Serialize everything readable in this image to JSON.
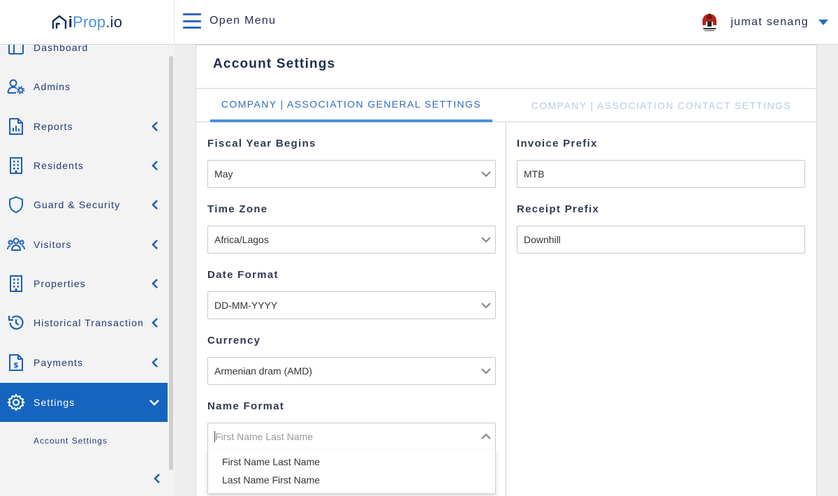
{
  "brand": {
    "i": "i",
    "prop": "Prop",
    "io": ".io"
  },
  "header": {
    "menu_label": "Open Menu",
    "user_name": "jumat senang"
  },
  "sidebar": {
    "items": [
      {
        "label": "Dashboard",
        "icon": "dashboard-icon"
      },
      {
        "label": "Admins",
        "icon": "admin-gear-icon"
      },
      {
        "label": "Reports",
        "icon": "report-icon"
      },
      {
        "label": "Residents",
        "icon": "building-icon"
      },
      {
        "label": "Guard & Security",
        "icon": "shield-icon"
      },
      {
        "label": "Visitors",
        "icon": "users-icon"
      },
      {
        "label": "Properties",
        "icon": "building-icon"
      },
      {
        "label": "Historical Transaction",
        "icon": "history-icon"
      },
      {
        "label": "Payments",
        "icon": "invoice-dollar-icon"
      },
      {
        "label": "Settings",
        "icon": "gear-icon"
      }
    ],
    "sub_item": "Account Settings"
  },
  "page": {
    "title": "Account Settings",
    "tabs": [
      {
        "label": "COMPANY | ASSOCIATION GENERAL SETTINGS",
        "active": true
      },
      {
        "label": "COMPANY | ASSOCIATION CONTACT SETTINGS",
        "active": false
      }
    ]
  },
  "form": {
    "fiscal_year": {
      "label": "Fiscal Year Begins",
      "value": "May"
    },
    "time_zone": {
      "label": "Time Zone",
      "value": "Africa/Lagos"
    },
    "date_format": {
      "label": "Date Format",
      "value": "DD-MM-YYYY"
    },
    "currency": {
      "label": "Currency",
      "value": "Armenian dram (AMD)"
    },
    "name_format": {
      "label": "Name Format",
      "placeholder": "First Name Last Name",
      "options": [
        "First Name Last Name",
        "Last Name First Name"
      ]
    },
    "invoice_prefix": {
      "label": "Invoice Prefix",
      "value": "MTB"
    },
    "receipt_prefix": {
      "label": "Receipt Prefix",
      "value": "Downhill"
    }
  },
  "colors": {
    "accent": "#2a6bbf",
    "active_nav": "#1565c0",
    "nav_text": "#1f3a78"
  }
}
